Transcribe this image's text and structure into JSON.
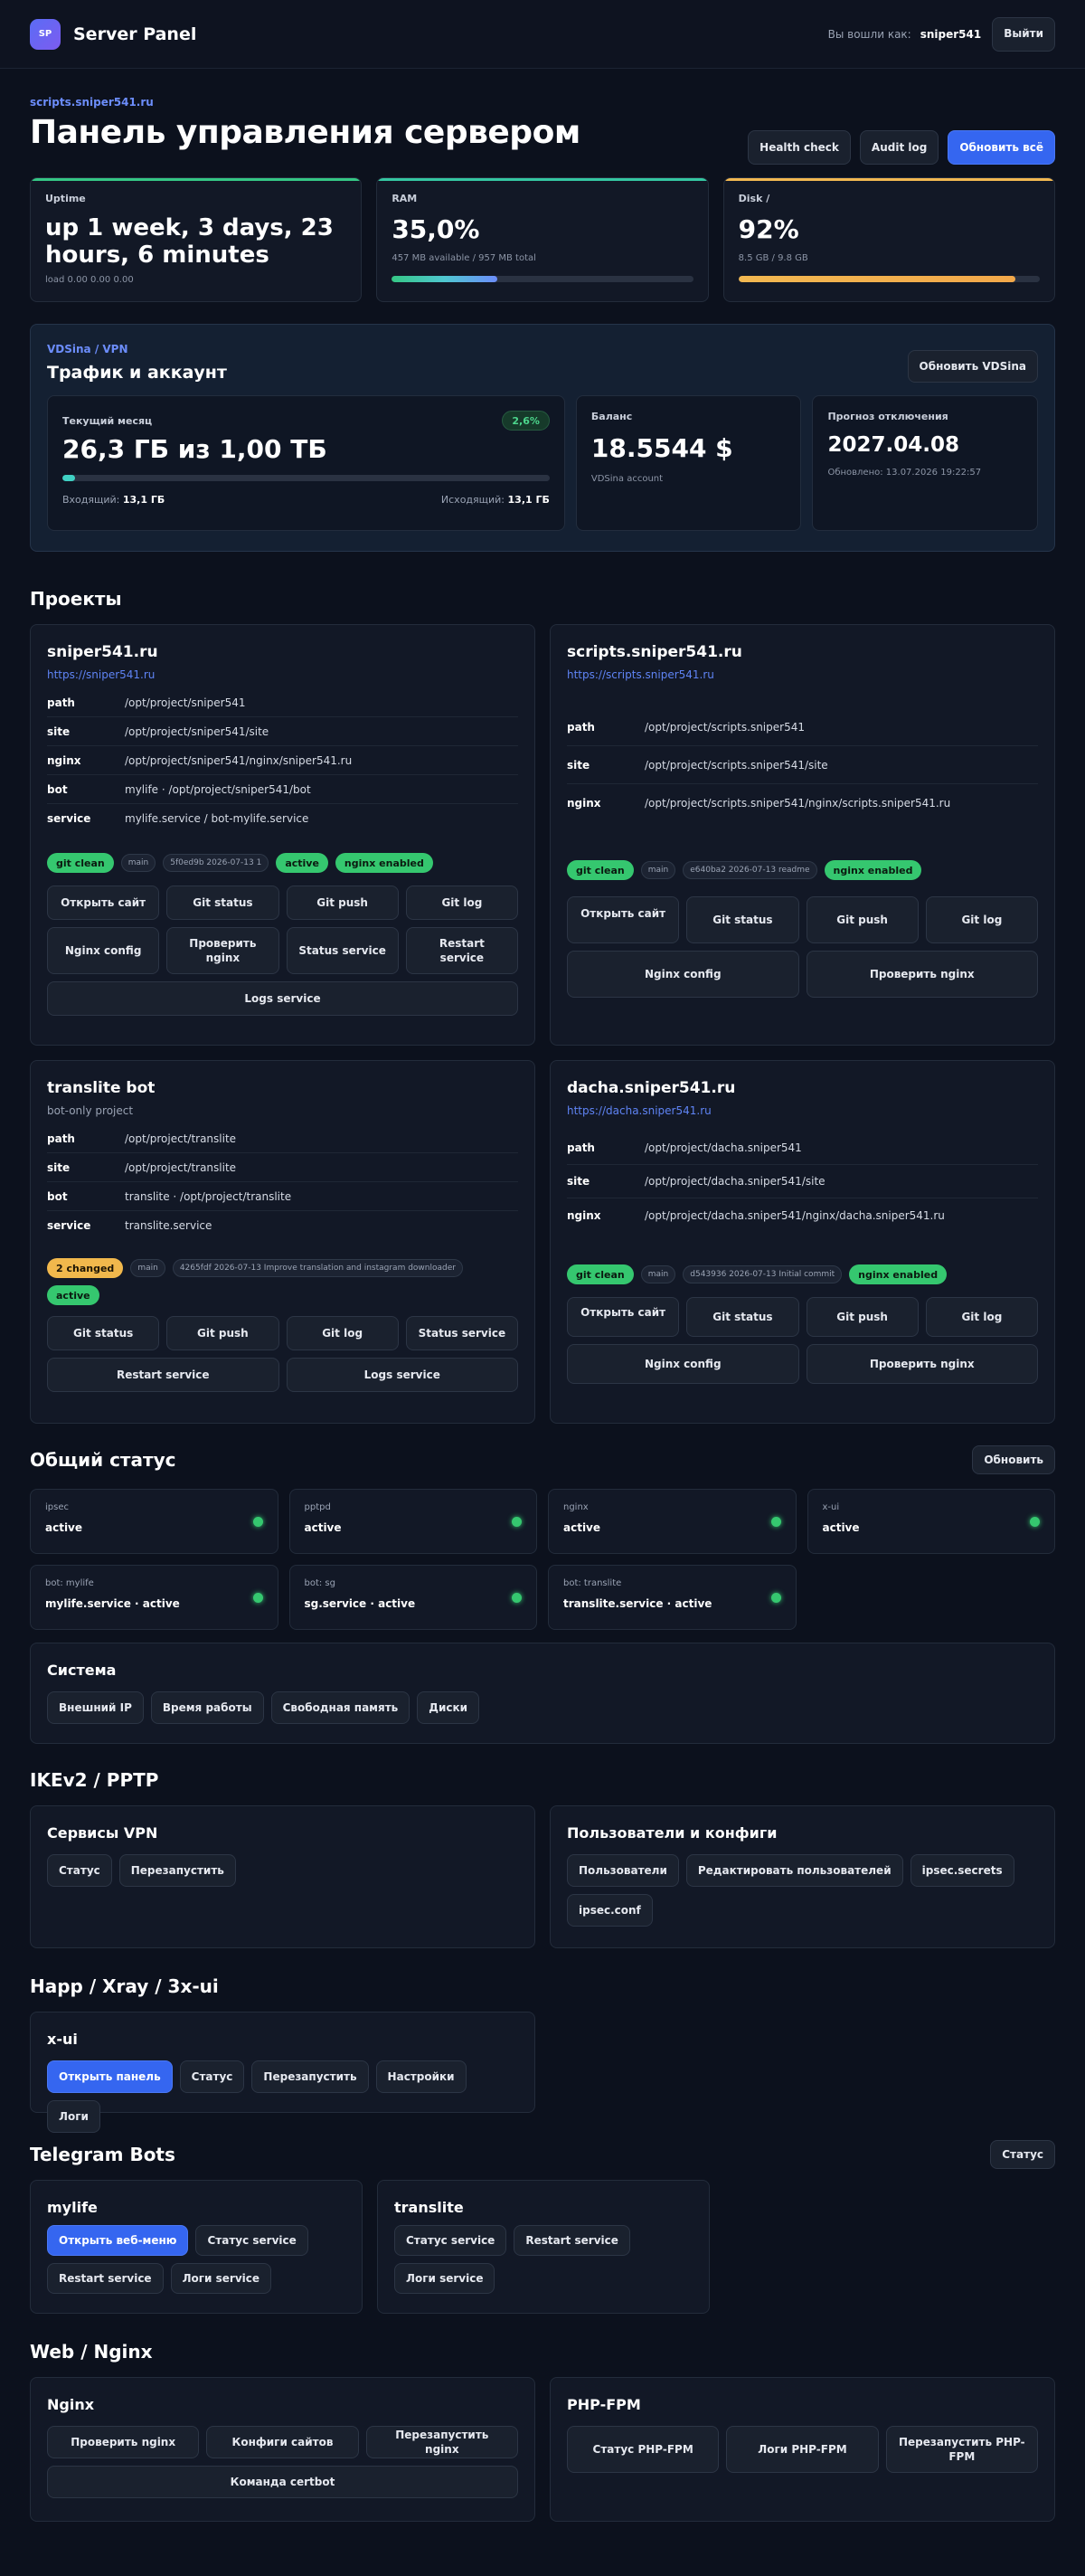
{
  "header": {
    "logo": "SP",
    "brand": "Server Panel",
    "logged_in_label": "Вы вошли как:",
    "username": "sniper541",
    "logout": "Выйти"
  },
  "hero": {
    "eyebrow": "scripts.sniper541.ru",
    "title": "Панель управления сервером",
    "health": "Health check",
    "audit": "Audit log",
    "refresh_all": "Обновить всё"
  },
  "stats": {
    "uptime": {
      "label": "Uptime",
      "value": "up 1 week, 3 days, 23 hours, 6 minutes",
      "sub": "load 0.00 0.00 0.00"
    },
    "ram": {
      "label": "RAM",
      "value": "35,0%",
      "sub": "457 MB available / 957 MB total",
      "percent": 35
    },
    "disk": {
      "label": "Disk /",
      "value": "92%",
      "sub": "8.5 GB / 9.8 GB",
      "percent": 92
    }
  },
  "colors": {
    "accent": "#3566f0",
    "green": "#35c76f",
    "yellow": "#f1b84c",
    "ram_bar": "#4fc7d0",
    "disk_bar": "#f2a84a",
    "traffic_bar": "#3fd0c3"
  },
  "vds": {
    "eyebrow": "VDSina / VPN",
    "title": "Трафик и аккаунт",
    "refresh": "Обновить VDSina",
    "month": {
      "label": "Текущий месяц",
      "value": "26,3 ГБ из 1,00 ТБ",
      "percent_label": "2,6%",
      "percent": 2.6,
      "in_label": "Входящий:",
      "in_value": "13,1 ГБ",
      "out_label": "Исходящий:",
      "out_value": "13,1 ГБ"
    },
    "balance": {
      "label": "Баланс",
      "value": "18.5544 $",
      "sub": "VDSina account"
    },
    "forecast": {
      "label": "Прогноз отключения",
      "value": "2027.04.08",
      "sub": "Обновлено: 13.07.2026 19:22:57"
    }
  },
  "projects_title": "Проекты",
  "p1": {
    "name": "sniper541.ru",
    "link": "https://sniper541.ru",
    "rows": [
      {
        "k": "path",
        "v": "/opt/project/sniper541"
      },
      {
        "k": "site",
        "v": "/opt/project/sniper541/site"
      },
      {
        "k": "nginx",
        "v": "/opt/project/sniper541/nginx/sniper541.ru"
      },
      {
        "k": "bot",
        "v": "mylife · /opt/project/sniper541/bot"
      },
      {
        "k": "service",
        "v": "mylife.service / bot-mylife.service"
      }
    ],
    "git": "git clean",
    "branch": "main",
    "commit": "5f0ed9b 2026-07-13 1",
    "svc": "active",
    "nginx": "nginx enabled",
    "buttons": [
      "Открыть сайт",
      "Git status",
      "Git push",
      "Git log",
      "Nginx config",
      "Проверить nginx",
      "Status service",
      "Restart service",
      "Logs service"
    ]
  },
  "p2": {
    "name": "scripts.sniper541.ru",
    "link": "https://scripts.sniper541.ru",
    "rows": [
      {
        "k": "path",
        "v": "/opt/project/scripts.sniper541"
      },
      {
        "k": "site",
        "v": "/opt/project/scripts.sniper541/site"
      },
      {
        "k": "nginx",
        "v": "/opt/project/scripts.sniper541/nginx/scripts.sniper541.ru"
      }
    ],
    "git": "git clean",
    "branch": "main",
    "commit": "e640ba2 2026-07-13 readme",
    "nginx": "nginx enabled",
    "buttons": [
      "Открыть сайт",
      "Git status",
      "Git push",
      "Git log",
      "Nginx config",
      "Проверить nginx"
    ]
  },
  "p3": {
    "name": "translite bot",
    "sub": "bot-only project",
    "rows": [
      {
        "k": "path",
        "v": "/opt/project/translite"
      },
      {
        "k": "site",
        "v": "/opt/project/translite"
      },
      {
        "k": "bot",
        "v": "translite · /opt/project/translite"
      },
      {
        "k": "service",
        "v": "translite.service"
      }
    ],
    "git": "2 changed",
    "branch": "main",
    "commit": "4265fdf 2026-07-13 Improve translation and instagram downloader",
    "svc": "active",
    "buttons": [
      "Git status",
      "Git push",
      "Git log",
      "Status service",
      "Restart service",
      "Logs service"
    ]
  },
  "p4": {
    "name": "dacha.sniper541.ru",
    "link": "https://dacha.sniper541.ru",
    "rows": [
      {
        "k": "path",
        "v": "/opt/project/dacha.sniper541"
      },
      {
        "k": "site",
        "v": "/opt/project/dacha.sniper541/site"
      },
      {
        "k": "nginx",
        "v": "/opt/project/dacha.sniper541/nginx/dacha.sniper541.ru"
      }
    ],
    "git": "git clean",
    "branch": "main",
    "commit": "d543936 2026-07-13 Initial commit",
    "nginx": "nginx enabled",
    "buttons": [
      "Открыть сайт",
      "Git status",
      "Git push",
      "Git log",
      "Nginx config",
      "Проверить nginx"
    ]
  },
  "status": {
    "title": "Общий статус",
    "refresh": "Обновить",
    "cards": [
      {
        "label": "ipsec",
        "value": "active"
      },
      {
        "label": "pptpd",
        "value": "active"
      },
      {
        "label": "nginx",
        "value": "active"
      },
      {
        "label": "x-ui",
        "value": "active"
      },
      {
        "label": "bot: mylife",
        "value": "mylife.service · active"
      },
      {
        "label": "bot: sg",
        "value": "sg.service · active"
      },
      {
        "label": "bot: translite",
        "value": "translite.service · active"
      }
    ]
  },
  "system": {
    "title": "Система",
    "buttons": [
      "Внешний IP",
      "Время работы",
      "Свободная память",
      "Диски"
    ]
  },
  "ikev2": {
    "title": "IKEv2 / PPTP",
    "vpn_title": "Сервисы VPN",
    "vpn_buttons": [
      "Статус",
      "Перезапустить"
    ],
    "users_title": "Пользователи и конфиги",
    "users_buttons": [
      "Пользователи",
      "Редактировать пользователей",
      "ipsec.secrets",
      "ipsec.conf"
    ]
  },
  "xray": {
    "title": "Happ / Xray / 3x-ui",
    "panel_title": "x-ui",
    "buttons": [
      "Открыть панель",
      "Статус",
      "Перезапустить",
      "Настройки",
      "Логи"
    ]
  },
  "bots": {
    "title": "Telegram Bots",
    "status": "Статус",
    "mylife": {
      "title": "mylife",
      "buttons": [
        "Открыть веб-меню",
        "Статус service",
        "Restart service",
        "Логи service"
      ]
    },
    "translite": {
      "title": "translite",
      "buttons": [
        "Статус service",
        "Restart service",
        "Логи service"
      ]
    }
  },
  "web": {
    "title": "Web / Nginx",
    "nginx_title": "Nginx",
    "nginx_buttons": [
      "Проверить nginx",
      "Конфиги сайтов",
      "Перезапустить nginx",
      "Команда certbot"
    ],
    "php_title": "PHP-FPM",
    "php_buttons": [
      "Статус PHP-FPM",
      "Логи PHP-FPM",
      "Перезапустить PHP-FPM"
    ]
  }
}
